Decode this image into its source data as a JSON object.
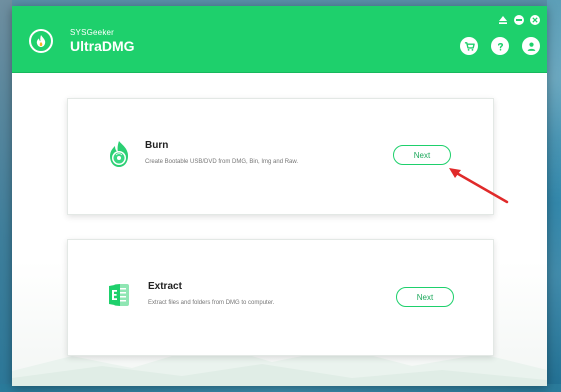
{
  "app": {
    "brand_small": "SYSGeeker",
    "brand_large": "UltraDMG"
  },
  "colors": {
    "accent": "#1ed06c",
    "arrow": "#e02a2a"
  },
  "toolbar": {
    "icons": [
      "cart-icon",
      "help-icon",
      "user-icon"
    ]
  },
  "window_controls": [
    "eject-icon",
    "minimize-icon",
    "close-icon"
  ],
  "cards": [
    {
      "title": "Burn",
      "description": "Create Bootable USB/DVD from DMG, Bin, Img and Raw.",
      "button_label": "Next",
      "icon": "burn-disc-icon"
    },
    {
      "title": "Extract",
      "description": "Extract files and folders from DMG to computer.",
      "button_label": "Next",
      "icon": "extract-file-icon"
    }
  ]
}
